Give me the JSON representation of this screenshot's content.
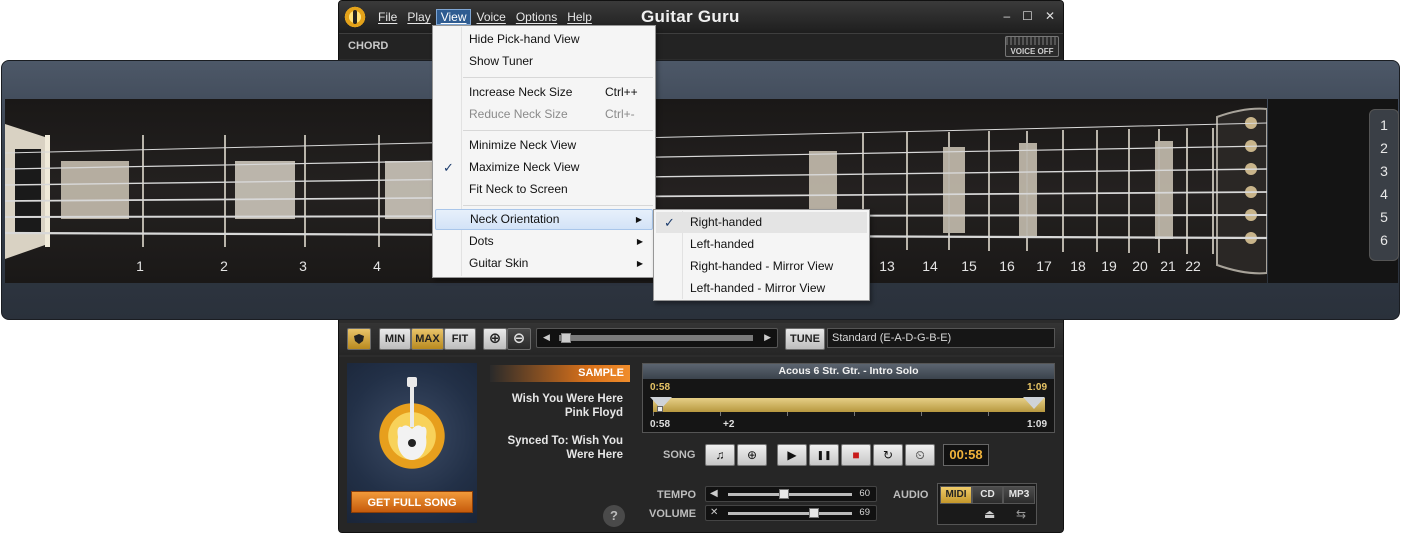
{
  "window": {
    "title": "Guitar Guru",
    "menu": [
      "File",
      "Play",
      "View",
      "Voice",
      "Options",
      "Help"
    ],
    "controls": [
      "–",
      "☐",
      "✕"
    ]
  },
  "chord_label": "CHORD",
  "voice_button": "VOICE OFF",
  "view_menu": {
    "items": [
      {
        "label": "Hide Pick-hand View"
      },
      {
        "label": "Show Tuner"
      },
      {
        "label": "Increase Neck Size",
        "shortcut": "Ctrl++"
      },
      {
        "label": "Reduce Neck Size",
        "shortcut": "Ctrl+-",
        "disabled": true
      },
      {
        "label": "Minimize Neck View"
      },
      {
        "label": "Maximize Neck View",
        "checked": true
      },
      {
        "label": "Fit Neck to Screen"
      },
      {
        "label": "Neck Orientation",
        "submenu": true,
        "highlighted": true
      },
      {
        "label": "Dots",
        "submenu": true
      },
      {
        "label": "Guitar Skin",
        "submenu": true
      }
    ]
  },
  "orientation_menu": {
    "items": [
      {
        "label": "Right-handed",
        "checked": true
      },
      {
        "label": "Left-handed"
      },
      {
        "label": "Right-handed - Mirror View"
      },
      {
        "label": "Left-handed - Mirror View"
      }
    ]
  },
  "fret_numbers": [
    "1",
    "2",
    "3",
    "4",
    "13",
    "14",
    "15",
    "16",
    "17",
    "18",
    "19",
    "20",
    "21",
    "22"
  ],
  "string_numbers": [
    "1",
    "2",
    "3",
    "4",
    "5",
    "6"
  ],
  "controls": {
    "size_buttons": [
      "MIN",
      "MAX",
      "FIT"
    ],
    "active_size": "MAX",
    "zoom_in": "⊕",
    "zoom_out": "⊖",
    "scroll_left": "◀",
    "scroll_right": "▶",
    "tune_button": "TUNE",
    "tuning": "Standard (E-A-D-G-B-E)"
  },
  "album": {
    "get_full_song": "GET FULL SONG",
    "sample_badge": "SAMPLE",
    "song_title": "Wish You Were Here",
    "artist": "Pink Floyd",
    "synced_line1": "Synced To: Wish You",
    "synced_line2": "Were Here",
    "help": "?"
  },
  "sequencer": {
    "track": "Acous 6 Str. Gtr. - Intro Solo",
    "start_top": "0:58",
    "end_top": "1:09",
    "start_bottom": "0:58",
    "transpose": "+2",
    "end_bottom": "1:09"
  },
  "transport": {
    "song_label": "SONG",
    "song_icons": [
      "♫",
      "⊕"
    ],
    "buttons": [
      "▶",
      "❚❚",
      "■",
      "↻",
      "⏲"
    ],
    "time": "00:58"
  },
  "mixer": {
    "tempo_label": "TEMPO",
    "tempo_value": "60",
    "tempo_level": 0.45,
    "volume_label": "VOLUME",
    "volume_value": "69",
    "volume_level": 0.69,
    "audio_label": "AUDIO",
    "audio_modes": [
      "MIDI",
      "CD",
      "MP3"
    ],
    "active_mode": "MIDI",
    "eject": "⏏",
    "loop": "⇆"
  },
  "colors": {
    "accent_gold": "#c4972b",
    "menu_highlight": "#d3e3f7",
    "timer": "#f1b33a",
    "sample_orange": "#d9711a"
  }
}
